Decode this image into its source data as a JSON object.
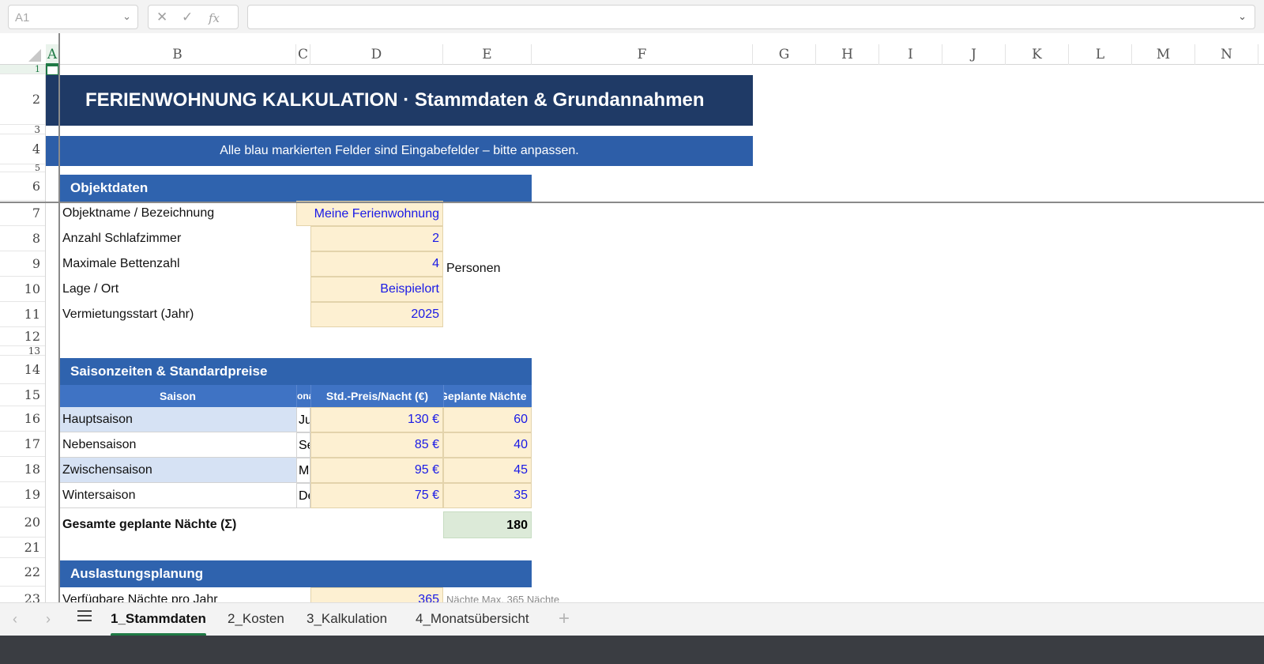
{
  "formula_bar": {
    "name_box": "A1",
    "formula": ""
  },
  "columns": [
    "A",
    "B",
    "C",
    "D",
    "E",
    "F",
    "G",
    "H",
    "I",
    "J",
    "K",
    "L",
    "M",
    "N"
  ],
  "rows": [
    "1",
    "2",
    "3",
    "4",
    "5",
    "6",
    "7",
    "8",
    "9",
    "10",
    "11",
    "12",
    "13",
    "14",
    "15",
    "16",
    "17",
    "18",
    "19",
    "20",
    "21",
    "22",
    "23"
  ],
  "sheet": {
    "title": "FERIENWOHNUNG KALKULATION  ·  Stammdaten & Grundannahmen",
    "banner": "Alle blau markierten Felder sind Eingabefelder – bitte anpassen.",
    "objekt": {
      "header": "Objektdaten",
      "rows": [
        {
          "label": "Objektname / Bezeichnung",
          "value": "Meine Ferienwohnung",
          "unit": ""
        },
        {
          "label": "Anzahl Schlafzimmer",
          "value": "2",
          "unit": ""
        },
        {
          "label": "Maximale Bettenzahl",
          "value": "4",
          "unit": "Personen"
        },
        {
          "label": "Lage / Ort",
          "value": "Beispielort",
          "unit": ""
        },
        {
          "label": "Vermietungsstart (Jahr)",
          "value": "2025",
          "unit": ""
        }
      ]
    },
    "saison": {
      "header": "Saisonzeiten & Standardpreise",
      "columns": [
        "Saison",
        "ona",
        "Std.-Preis/Nacht (€)",
        "Geplante Nächte"
      ],
      "rows": [
        {
          "name": "Hauptsaison",
          "c": "Ju",
          "price": "130 €",
          "nights": "60"
        },
        {
          "name": "Nebensaison",
          "c": "Se",
          "price": "85 €",
          "nights": "40"
        },
        {
          "name": "Zwischensaison",
          "c": "M",
          "price": "95 €",
          "nights": "45"
        },
        {
          "name": "Wintersaison",
          "c": "De",
          "price": "75 €",
          "nights": "35"
        }
      ],
      "total_label": "Gesamte geplante Nächte (Σ)",
      "total_value": "180"
    },
    "auslastung": {
      "header": "Auslastungsplanung",
      "row_label": "Verfügbare Nächte pro Jahr",
      "row_value": "365",
      "row_note": "Nächte     Max. 365 Nächte"
    }
  },
  "tabs": [
    "1_Stammdaten",
    "2_Kosten",
    "3_Kalkulation",
    "4_Monatsübersicht"
  ],
  "active_tab": "1_Stammdaten"
}
